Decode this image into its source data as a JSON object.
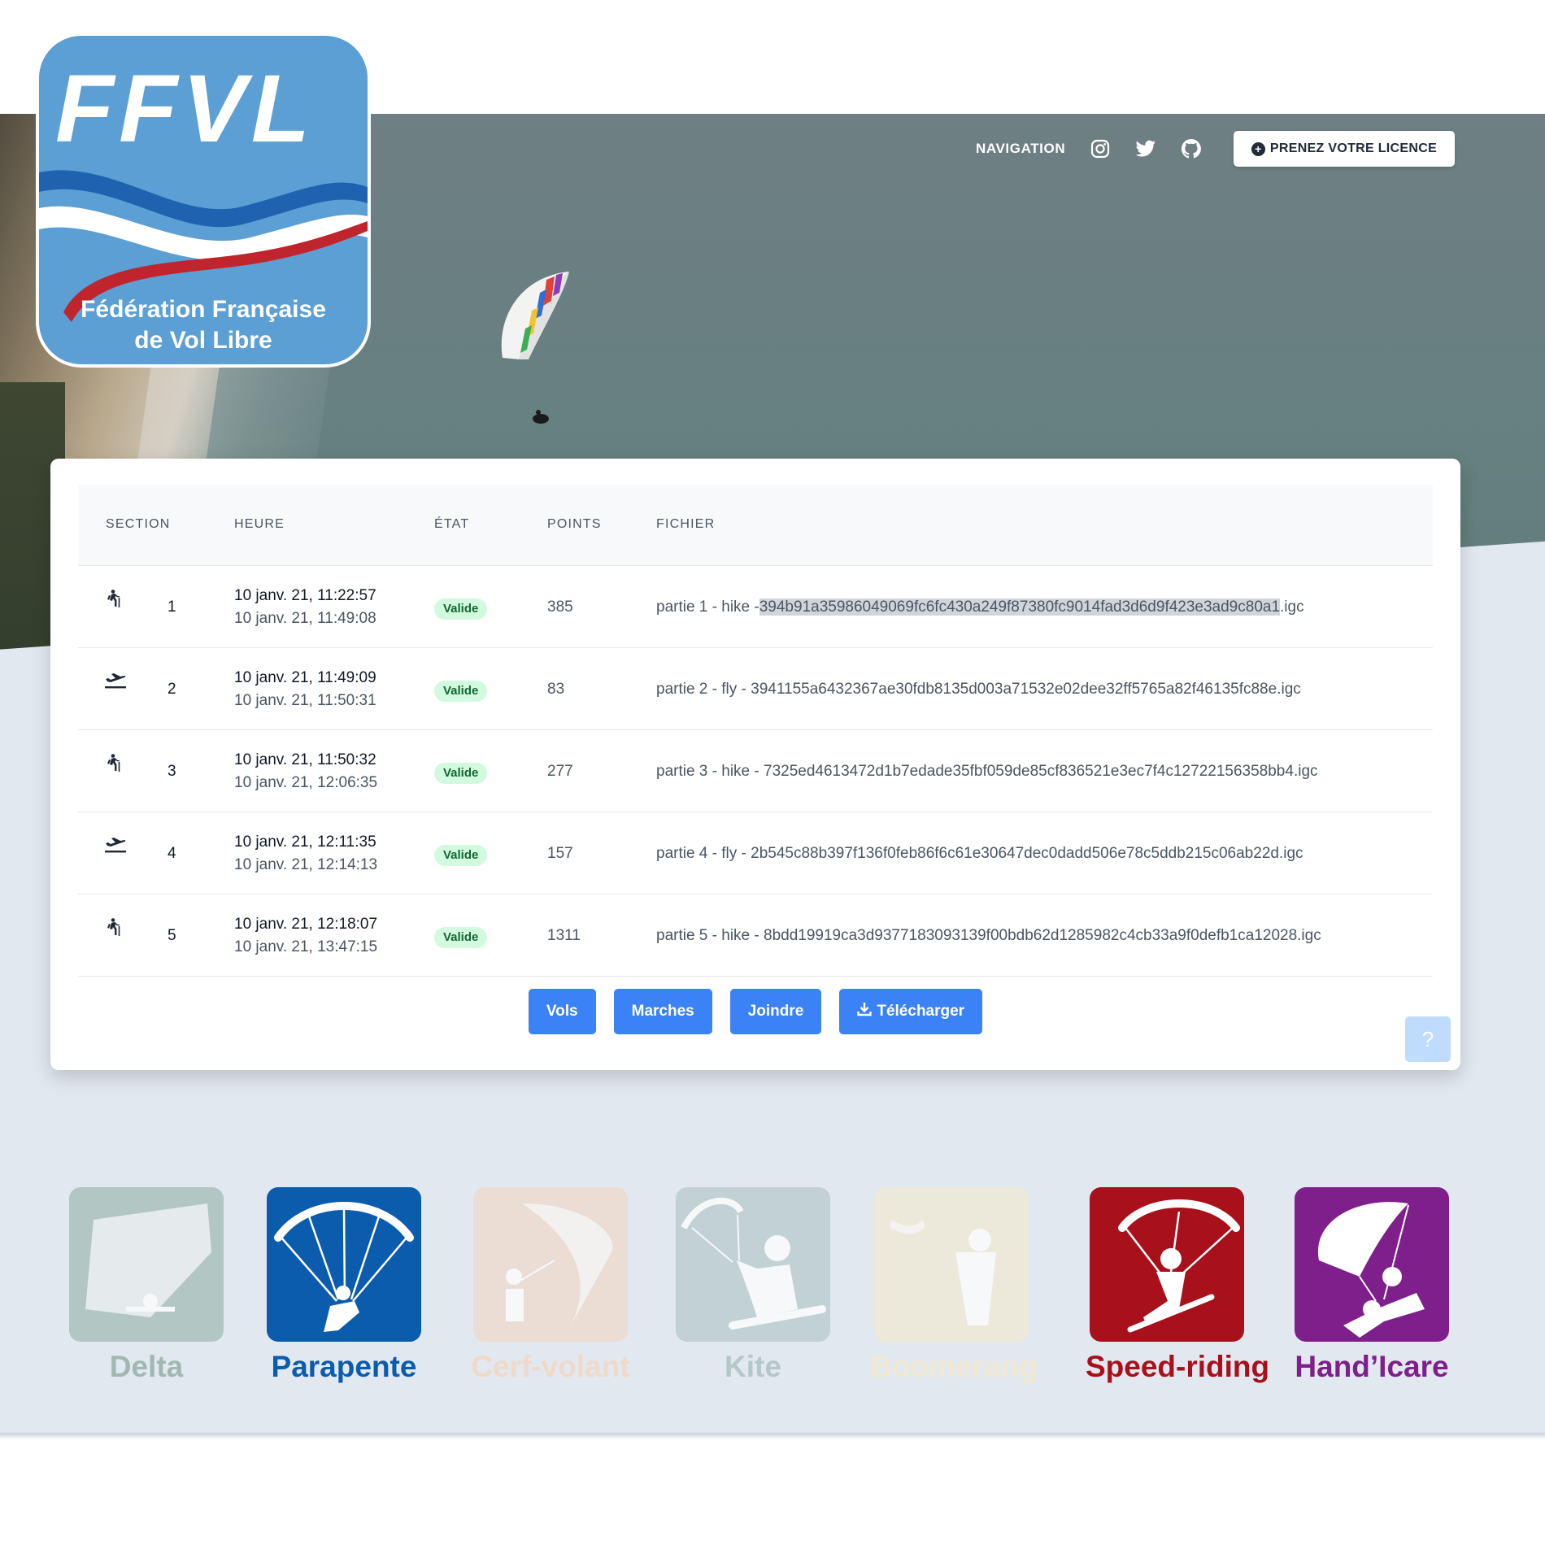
{
  "logo": {
    "acronym": "FFVL",
    "line1": "Fédération Française",
    "line2": "de Vol Libre",
    "colors": {
      "blue": "#5b9fd4",
      "darkblue": "#1f63b0",
      "red": "#c0252e"
    }
  },
  "header": {
    "nav_label": "NAVIGATION",
    "social": [
      "instagram-icon",
      "twitter-icon",
      "github-icon"
    ],
    "licence_button": "PRENEZ VOTRE LICENCE"
  },
  "table": {
    "headers": [
      "SECTION",
      "HEURE",
      "ÉTAT",
      "POINTS",
      "FICHIER"
    ],
    "rows": [
      {
        "type": "hike",
        "section": "1",
        "start": "10 janv. 21, 11:22:57",
        "end": "10 janv. 21, 11:49:08",
        "state": "Valide",
        "points": "385",
        "file_prefix": "partie 1 - hike -",
        "file_hash": "394b91a35986049069fc6fc430a249f87380fc9014fad3d6d9f423e3ad9c80a1",
        "file_ext": ".igc"
      },
      {
        "type": "fly",
        "section": "2",
        "start": "10 janv. 21, 11:49:09",
        "end": "10 janv. 21, 11:50:31",
        "state": "Valide",
        "points": "83",
        "file_prefix": "partie 2 - fly - ",
        "file_hash": "3941155a6432367ae30fdb8135d003a71532e02dee32ff5765a82f46135fc88e",
        "file_ext": ".igc"
      },
      {
        "type": "hike",
        "section": "3",
        "start": "10 janv. 21, 11:50:32",
        "end": "10 janv. 21, 12:06:35",
        "state": "Valide",
        "points": "277",
        "file_prefix": "partie 3 - hike - ",
        "file_hash": "7325ed4613472d1b7edade35fbf059de85cf836521e3ec7f4c12722156358bb4",
        "file_ext": ".igc"
      },
      {
        "type": "fly",
        "section": "4",
        "start": "10 janv. 21, 12:11:35",
        "end": "10 janv. 21, 12:14:13",
        "state": "Valide",
        "points": "157",
        "file_prefix": "partie 4 - fly - ",
        "file_hash": "2b545c88b397f136f0feb86f6c61e30647dec0dadd506e78c5ddb215c06ab22d",
        "file_ext": ".igc"
      },
      {
        "type": "hike",
        "section": "5",
        "start": "10 janv. 21, 12:18:07",
        "end": "10 janv. 21, 13:47:15",
        "state": "Valide",
        "points": "1311",
        "file_prefix": "partie 5 - hike - ",
        "file_hash": "8bdd19919ca3d9377183093139f00bdb62d1285982c4cb33a9f0defb1ca12028",
        "file_ext": ".igc"
      }
    ]
  },
  "actions": {
    "vols": "Vols",
    "marches": "Marches",
    "joindre": "Joindre",
    "telecharger": "Télécharger",
    "help": "?"
  },
  "disciplines": [
    {
      "label": "Delta",
      "color": "#9fb9b0",
      "faded": true
    },
    {
      "label": "Parapente",
      "color": "#0b5cad",
      "faded": false
    },
    {
      "label": "Cerf-volant",
      "color": "#efd9c8",
      "faded": true
    },
    {
      "label": "Kite",
      "color": "#b5c8c8",
      "faded": true
    },
    {
      "label": "Boomerang",
      "color": "#f1e8d2",
      "faded": true
    },
    {
      "label": "Speed-riding",
      "color": "#a8101b",
      "faded": false
    },
    {
      "label": "Hand’Icare",
      "color": "#7e1f8c",
      "faded": false
    }
  ]
}
